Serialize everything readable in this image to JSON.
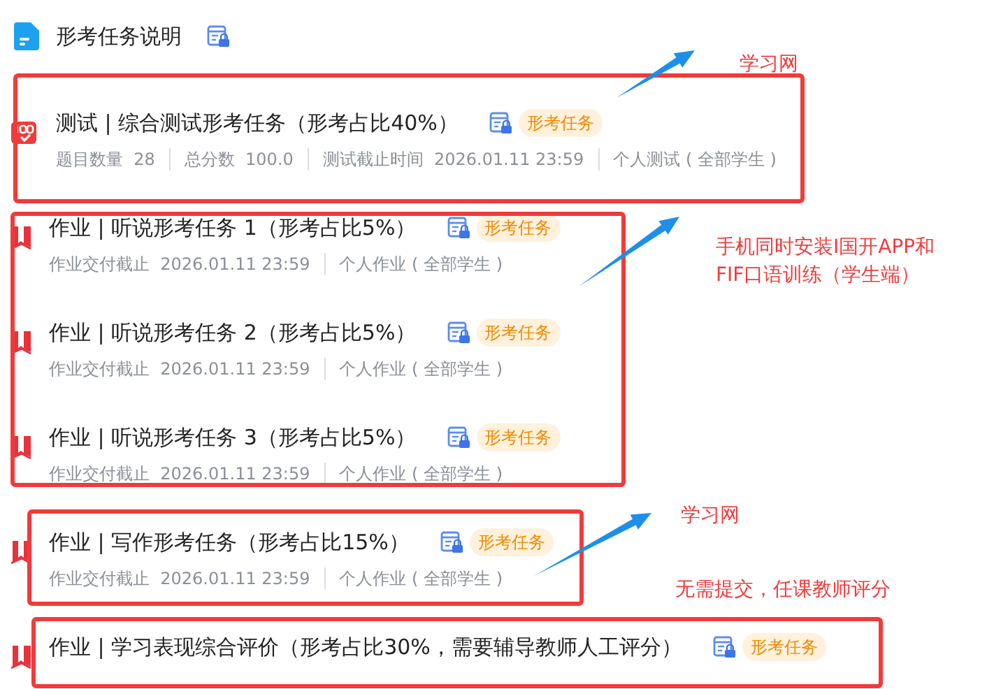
{
  "header": {
    "title": "形考任务说明",
    "locked": true
  },
  "tasks": [
    {
      "kind": "test",
      "title": "测试 | 综合测试形考任务（形考占比40%）",
      "locked": true,
      "tag": "形考任务",
      "meta": [
        "题目数量  28",
        "总分数  100.0",
        "测试截止时间  2026.01.11 23:59",
        "个人测试 ( 全部学生 )"
      ]
    },
    {
      "kind": "homework",
      "title": "作业 | 听说形考任务 1（形考占比5%）",
      "locked": true,
      "tag": "形考任务",
      "meta": [
        "作业交付截止  2026.01.11 23:59",
        "个人作业 ( 全部学生 )"
      ]
    },
    {
      "kind": "homework",
      "title": "作业 | 听说形考任务 2（形考占比5%）",
      "locked": true,
      "tag": "形考任务",
      "meta": [
        "作业交付截止  2026.01.11 23:59",
        "个人作业 ( 全部学生 )"
      ]
    },
    {
      "kind": "homework",
      "title": "作业 | 听说形考任务 3（形考占比5%）",
      "locked": true,
      "tag": "形考任务",
      "meta": [
        "作业交付截止  2026.01.11 23:59",
        "个人作业 ( 全部学生 )"
      ]
    },
    {
      "kind": "homework",
      "title": "作业 | 写作形考任务（形考占比15%）",
      "locked": true,
      "tag": "形考任务",
      "meta": [
        "作业交付截止  2026.01.11 23:59",
        "个人作业 ( 全部学生 )"
      ]
    },
    {
      "kind": "homework",
      "title": "作业 | 学习表现综合评价（形考占比30%，需要辅导教师人工评分）",
      "locked": true,
      "tag": "形考任务"
    }
  ],
  "annotations": [
    {
      "lines": [
        "学习网"
      ]
    },
    {
      "lines": [
        "手机同时安装I国开APP和",
        "FIF口语训练（学生端）"
      ]
    },
    {
      "lines": [
        "学习网"
      ]
    },
    {
      "lines": [
        "无需提交，任课教师评分"
      ]
    }
  ]
}
